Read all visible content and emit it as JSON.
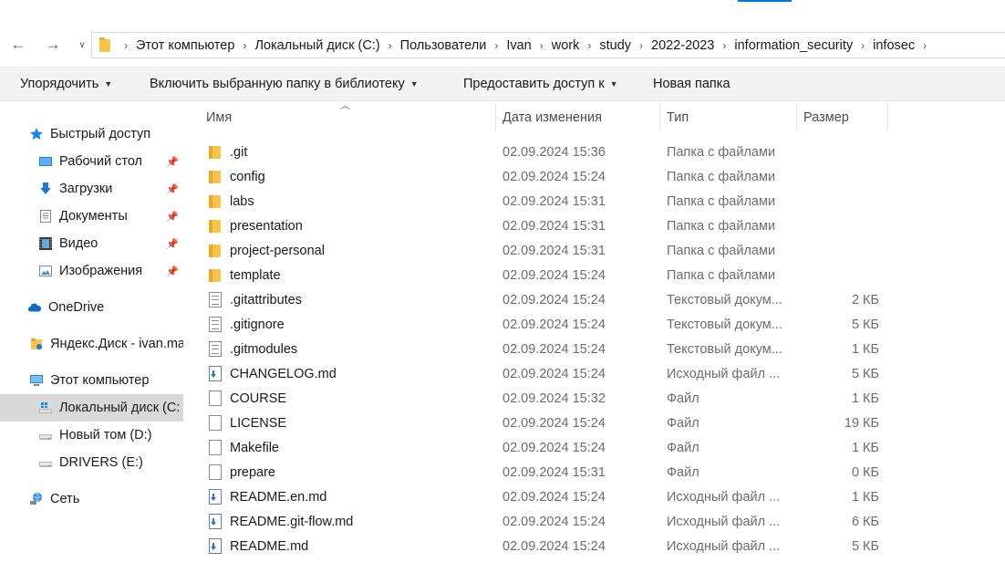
{
  "nav": {
    "back": "←",
    "forward": "→",
    "recent": "∨"
  },
  "breadcrumb": [
    "Этот компьютер",
    "Локальный диск (C:)",
    "Пользователи",
    "Ivan",
    "work",
    "study",
    "2022-2023",
    "information_security",
    "infosec"
  ],
  "breadcrumb_sep": "›",
  "toolbar": {
    "organize": "Упорядочить",
    "include_library": "Включить выбранную папку в библиотеку",
    "share": "Предоставить доступ к",
    "new_folder": "Новая папка"
  },
  "sidebar": {
    "quick_access": "Быстрый доступ",
    "desktop": "Рабочий стол",
    "downloads": "Загрузки",
    "documents": "Документы",
    "video": "Видео",
    "images": "Изображения",
    "onedrive": "OneDrive",
    "yandex": "Яндекс.Диск - ivan.ma",
    "this_pc": "Этот компьютер",
    "disk_c": "Локальный диск (C:",
    "disk_d": "Новый том (D:)",
    "disk_e": "DRIVERS (E:)",
    "network": "Сеть"
  },
  "columns": {
    "name": "Имя",
    "date": "Дата изменения",
    "type": "Тип",
    "size": "Размер"
  },
  "files": [
    {
      "name": ".git",
      "date": "02.09.2024 15:36",
      "type": "Папка с файлами",
      "size": "",
      "icon": "folder"
    },
    {
      "name": "config",
      "date": "02.09.2024 15:24",
      "type": "Папка с файлами",
      "size": "",
      "icon": "folder"
    },
    {
      "name": "labs",
      "date": "02.09.2024 15:31",
      "type": "Папка с файлами",
      "size": "",
      "icon": "folder"
    },
    {
      "name": "presentation",
      "date": "02.09.2024 15:31",
      "type": "Папка с файлами",
      "size": "",
      "icon": "folder"
    },
    {
      "name": "project-personal",
      "date": "02.09.2024 15:31",
      "type": "Папка с файлами",
      "size": "",
      "icon": "folder"
    },
    {
      "name": "template",
      "date": "02.09.2024 15:24",
      "type": "Папка с файлами",
      "size": "",
      "icon": "folder"
    },
    {
      "name": ".gitattributes",
      "date": "02.09.2024 15:24",
      "type": "Текстовый докум...",
      "size": "2 КБ",
      "icon": "text"
    },
    {
      "name": ".gitignore",
      "date": "02.09.2024 15:24",
      "type": "Текстовый докум...",
      "size": "5 КБ",
      "icon": "text"
    },
    {
      "name": ".gitmodules",
      "date": "02.09.2024 15:24",
      "type": "Текстовый докум...",
      "size": "1 КБ",
      "icon": "text"
    },
    {
      "name": "CHANGELOG.md",
      "date": "02.09.2024 15:24",
      "type": "Исходный файл ...",
      "size": "5 КБ",
      "icon": "md"
    },
    {
      "name": "COURSE",
      "date": "02.09.2024 15:32",
      "type": "Файл",
      "size": "1 КБ",
      "icon": "file"
    },
    {
      "name": "LICENSE",
      "date": "02.09.2024 15:24",
      "type": "Файл",
      "size": "19 КБ",
      "icon": "file"
    },
    {
      "name": "Makefile",
      "date": "02.09.2024 15:24",
      "type": "Файл",
      "size": "1 КБ",
      "icon": "file"
    },
    {
      "name": "prepare",
      "date": "02.09.2024 15:31",
      "type": "Файл",
      "size": "0 КБ",
      "icon": "file"
    },
    {
      "name": "README.en.md",
      "date": "02.09.2024 15:24",
      "type": "Исходный файл ...",
      "size": "1 КБ",
      "icon": "md"
    },
    {
      "name": "README.git-flow.md",
      "date": "02.09.2024 15:24",
      "type": "Исходный файл ...",
      "size": "6 КБ",
      "icon": "md"
    },
    {
      "name": "README.md",
      "date": "02.09.2024 15:24",
      "type": "Исходный файл ...",
      "size": "5 КБ",
      "icon": "md"
    }
  ]
}
